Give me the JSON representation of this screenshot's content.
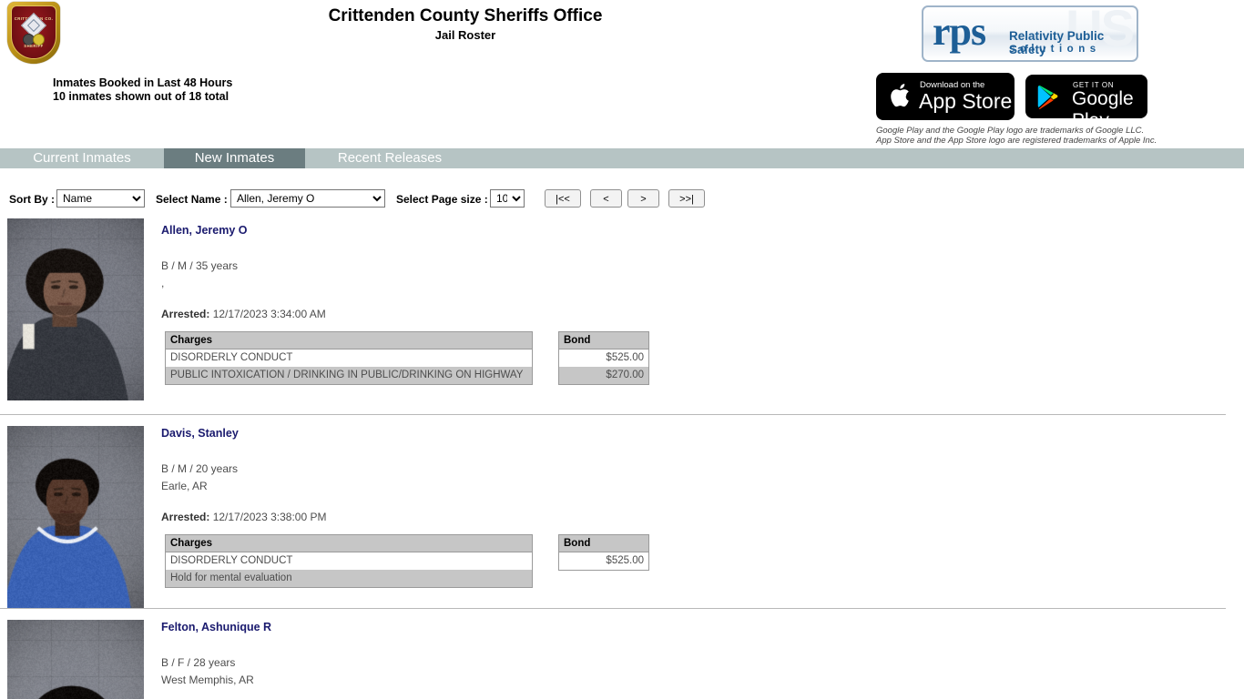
{
  "header": {
    "title": "Crittenden County Sheriffs Office",
    "subtitle": "Jail Roster",
    "badge_icon": "sheriff-badge-icon",
    "badge_text_top": "CRITTENDEN CO.",
    "badge_text_bottom": "SHERIFF",
    "count_line1": "Inmates Booked in Last 48 Hours",
    "count_line2": "10 inmates shown out of 18 total",
    "logo": {
      "mark": "rps",
      "line1": "Relativity Public Safety",
      "line2": "solutions",
      "ghost": "US"
    },
    "apple_badge": {
      "sub": "Download on the",
      "main": "App Store"
    },
    "google_badge": {
      "sub": "GET IT ON",
      "main": "Google Play"
    },
    "trademark_line1": "Google Play and the Google Play logo are trademarks of Google LLC.",
    "trademark_line2": "App Store and the App Store logo are registered trademarks of Apple Inc."
  },
  "tabs": [
    {
      "label": "Current Inmates",
      "active": false
    },
    {
      "label": "New Inmates",
      "active": true
    },
    {
      "label": "Recent Releases",
      "active": false
    }
  ],
  "controls": {
    "sort_label": "Sort By :",
    "sort_value": "Name",
    "name_label": "Select Name :",
    "name_value": "Allen, Jeremy O",
    "pagesize_label": "Select Page size :",
    "pagesize_value": "10",
    "paging": {
      "first": "|<<",
      "prev": "<",
      "next": ">",
      "last": ">>|"
    }
  },
  "table_headers": {
    "charges": "Charges",
    "bond": "Bond"
  },
  "inmates": [
    {
      "name": "Allen, Jeremy O",
      "demographics": "B / M / 35 years",
      "location": ",",
      "arrested_label": "Arrested:",
      "arrested_value": "12/17/2023 3:34:00 AM",
      "charges": [
        {
          "charge": "DISORDERLY CONDUCT",
          "bond": "$525.00"
        },
        {
          "charge": "PUBLIC INTOXICATION / DRINKING IN PUBLIC/DRINKING ON HIGHWAY",
          "bond": "$270.00"
        }
      ],
      "mug_alt": "mugshot-allen-jeremy"
    },
    {
      "name": "Davis, Stanley",
      "demographics": "B / M / 20 years",
      "location": "Earle, AR",
      "arrested_label": "Arrested:",
      "arrested_value": "12/17/2023 3:38:00 PM",
      "charges": [
        {
          "charge": "DISORDERLY CONDUCT",
          "bond": "$525.00"
        },
        {
          "charge": "Hold for mental evaluation",
          "bond": ""
        }
      ],
      "mug_alt": "mugshot-davis-stanley"
    },
    {
      "name": "Felton, Ashunique R",
      "demographics": "B / F / 28 years",
      "location": "West Memphis, AR",
      "arrested_label": "",
      "arrested_value": "",
      "charges": [],
      "mug_alt": "mugshot-felton-ashunique"
    }
  ],
  "colors": {
    "tabbar_bg": "#b6c4c4",
    "tab_active_bg": "#6b7d80",
    "name_link": "#1a1a6e",
    "table_header_bg": "#c6c6c6",
    "brand_blue": "#1d5e96"
  }
}
